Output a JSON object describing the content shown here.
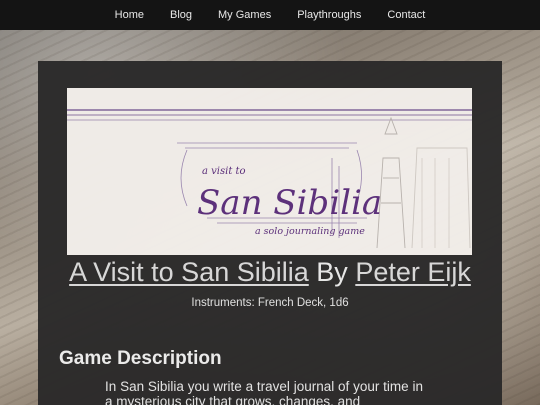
{
  "nav": {
    "items": [
      {
        "label": "Home"
      },
      {
        "label": "Blog"
      },
      {
        "label": "My Games"
      },
      {
        "label": "Playthroughs"
      },
      {
        "label": "Contact"
      }
    ]
  },
  "banner": {
    "small_text": "a visit to",
    "logo_text": "San Sibilia",
    "tagline": "a solo journaling game",
    "accent_color": "#5a2d7a"
  },
  "game": {
    "title": "A Visit to San Sibilia",
    "by": "By",
    "author": "Peter Eijk",
    "instruments": "Instruments: French Deck, 1d6"
  },
  "description": {
    "heading": "Game Description",
    "text": "In San Sibilia you write a travel journal of your time in a mysterious city that grows, changes, and"
  },
  "colors": {
    "navbar": "#141414",
    "card": "#2b2a2a",
    "text": "#e9e9e9"
  }
}
